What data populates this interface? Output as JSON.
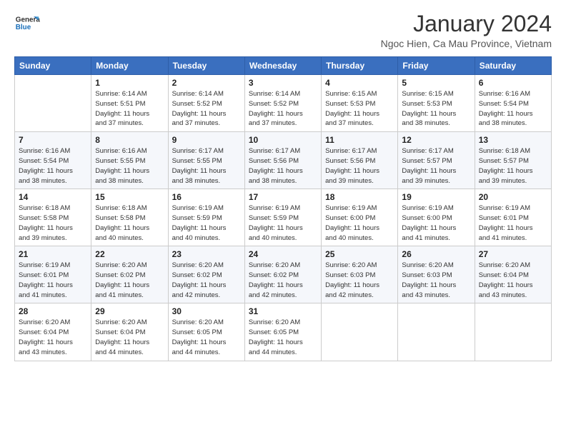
{
  "header": {
    "logo_line1": "General",
    "logo_line2": "Blue",
    "month_title": "January 2024",
    "location": "Ngoc Hien, Ca Mau Province, Vietnam"
  },
  "days_of_week": [
    "Sunday",
    "Monday",
    "Tuesday",
    "Wednesday",
    "Thursday",
    "Friday",
    "Saturday"
  ],
  "weeks": [
    [
      {
        "day": "",
        "info": ""
      },
      {
        "day": "1",
        "info": "Sunrise: 6:14 AM\nSunset: 5:51 PM\nDaylight: 11 hours\nand 37 minutes."
      },
      {
        "day": "2",
        "info": "Sunrise: 6:14 AM\nSunset: 5:52 PM\nDaylight: 11 hours\nand 37 minutes."
      },
      {
        "day": "3",
        "info": "Sunrise: 6:14 AM\nSunset: 5:52 PM\nDaylight: 11 hours\nand 37 minutes."
      },
      {
        "day": "4",
        "info": "Sunrise: 6:15 AM\nSunset: 5:53 PM\nDaylight: 11 hours\nand 37 minutes."
      },
      {
        "day": "5",
        "info": "Sunrise: 6:15 AM\nSunset: 5:53 PM\nDaylight: 11 hours\nand 38 minutes."
      },
      {
        "day": "6",
        "info": "Sunrise: 6:16 AM\nSunset: 5:54 PM\nDaylight: 11 hours\nand 38 minutes."
      }
    ],
    [
      {
        "day": "7",
        "info": "Sunrise: 6:16 AM\nSunset: 5:54 PM\nDaylight: 11 hours\nand 38 minutes."
      },
      {
        "day": "8",
        "info": "Sunrise: 6:16 AM\nSunset: 5:55 PM\nDaylight: 11 hours\nand 38 minutes."
      },
      {
        "day": "9",
        "info": "Sunrise: 6:17 AM\nSunset: 5:55 PM\nDaylight: 11 hours\nand 38 minutes."
      },
      {
        "day": "10",
        "info": "Sunrise: 6:17 AM\nSunset: 5:56 PM\nDaylight: 11 hours\nand 38 minutes."
      },
      {
        "day": "11",
        "info": "Sunrise: 6:17 AM\nSunset: 5:56 PM\nDaylight: 11 hours\nand 39 minutes."
      },
      {
        "day": "12",
        "info": "Sunrise: 6:17 AM\nSunset: 5:57 PM\nDaylight: 11 hours\nand 39 minutes."
      },
      {
        "day": "13",
        "info": "Sunrise: 6:18 AM\nSunset: 5:57 PM\nDaylight: 11 hours\nand 39 minutes."
      }
    ],
    [
      {
        "day": "14",
        "info": "Sunrise: 6:18 AM\nSunset: 5:58 PM\nDaylight: 11 hours\nand 39 minutes."
      },
      {
        "day": "15",
        "info": "Sunrise: 6:18 AM\nSunset: 5:58 PM\nDaylight: 11 hours\nand 40 minutes."
      },
      {
        "day": "16",
        "info": "Sunrise: 6:19 AM\nSunset: 5:59 PM\nDaylight: 11 hours\nand 40 minutes."
      },
      {
        "day": "17",
        "info": "Sunrise: 6:19 AM\nSunset: 5:59 PM\nDaylight: 11 hours\nand 40 minutes."
      },
      {
        "day": "18",
        "info": "Sunrise: 6:19 AM\nSunset: 6:00 PM\nDaylight: 11 hours\nand 40 minutes."
      },
      {
        "day": "19",
        "info": "Sunrise: 6:19 AM\nSunset: 6:00 PM\nDaylight: 11 hours\nand 41 minutes."
      },
      {
        "day": "20",
        "info": "Sunrise: 6:19 AM\nSunset: 6:01 PM\nDaylight: 11 hours\nand 41 minutes."
      }
    ],
    [
      {
        "day": "21",
        "info": "Sunrise: 6:19 AM\nSunset: 6:01 PM\nDaylight: 11 hours\nand 41 minutes."
      },
      {
        "day": "22",
        "info": "Sunrise: 6:20 AM\nSunset: 6:02 PM\nDaylight: 11 hours\nand 41 minutes."
      },
      {
        "day": "23",
        "info": "Sunrise: 6:20 AM\nSunset: 6:02 PM\nDaylight: 11 hours\nand 42 minutes."
      },
      {
        "day": "24",
        "info": "Sunrise: 6:20 AM\nSunset: 6:02 PM\nDaylight: 11 hours\nand 42 minutes."
      },
      {
        "day": "25",
        "info": "Sunrise: 6:20 AM\nSunset: 6:03 PM\nDaylight: 11 hours\nand 42 minutes."
      },
      {
        "day": "26",
        "info": "Sunrise: 6:20 AM\nSunset: 6:03 PM\nDaylight: 11 hours\nand 43 minutes."
      },
      {
        "day": "27",
        "info": "Sunrise: 6:20 AM\nSunset: 6:04 PM\nDaylight: 11 hours\nand 43 minutes."
      }
    ],
    [
      {
        "day": "28",
        "info": "Sunrise: 6:20 AM\nSunset: 6:04 PM\nDaylight: 11 hours\nand 43 minutes."
      },
      {
        "day": "29",
        "info": "Sunrise: 6:20 AM\nSunset: 6:04 PM\nDaylight: 11 hours\nand 44 minutes."
      },
      {
        "day": "30",
        "info": "Sunrise: 6:20 AM\nSunset: 6:05 PM\nDaylight: 11 hours\nand 44 minutes."
      },
      {
        "day": "31",
        "info": "Sunrise: 6:20 AM\nSunset: 6:05 PM\nDaylight: 11 hours\nand 44 minutes."
      },
      {
        "day": "",
        "info": ""
      },
      {
        "day": "",
        "info": ""
      },
      {
        "day": "",
        "info": ""
      }
    ]
  ]
}
